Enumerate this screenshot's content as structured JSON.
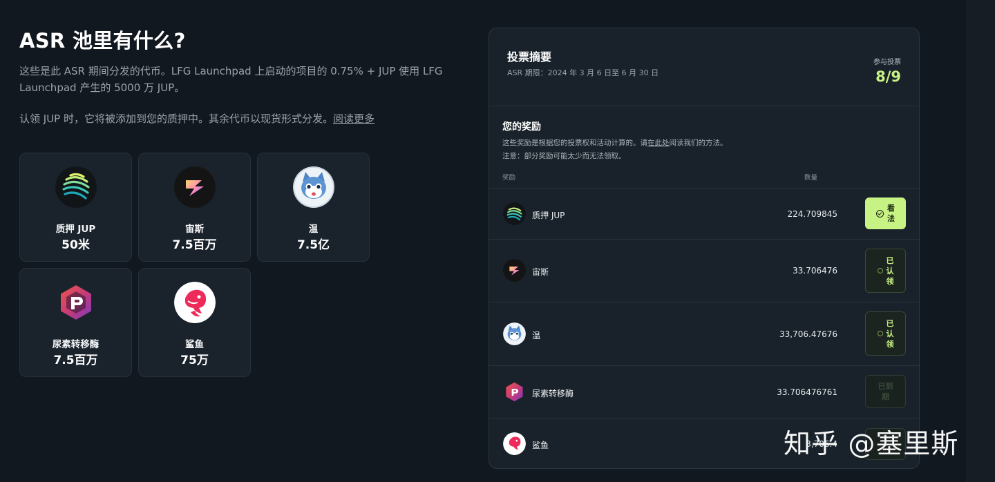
{
  "page": {
    "title": "ASR 池里有什么?",
    "intro": "这些是此 ASR 期间分发的代币。LFG Launchpad 上启动的项目的 0.75% + JUP 使用 LFG Launchpad 产生的 5000 万 JUP。",
    "note": "认领 JUP 时，它将被添加到您的质押中。其余代币以现货形式分发。",
    "read_more": "阅读更多"
  },
  "tokens": [
    {
      "name": "质押 JUP",
      "amount": "50米",
      "icon": "jupiter-logo-icon"
    },
    {
      "name": "宙斯",
      "amount": "7.5百万",
      "icon": "zeus-logo-icon"
    },
    {
      "name": "温",
      "amount": "7.5亿",
      "icon": "wen-cat-logo-icon"
    },
    {
      "name": "尿素转移酶",
      "amount": "7.5百万",
      "icon": "upt-logo-icon"
    },
    {
      "name": "鲨鱼",
      "amount": "75万",
      "icon": "shark-logo-icon"
    }
  ],
  "summary": {
    "title": "投票摘要",
    "period": "ASR 期限：2024 年 3 月 6 日至 6 月 30 日",
    "vote_label": "参与投票",
    "vote_count": "8/9"
  },
  "rewards": {
    "title": "您的奖励",
    "desc_before": "这些奖励是根据您的投票权和活动计算的。请",
    "desc_link": "在此处",
    "desc_after": "阅读我们的方法。",
    "note": "注意：部分奖励可能太少而无法领取。",
    "col_reward": "奖励",
    "col_qty": "数量",
    "rows": [
      {
        "name": "质押 JUP",
        "qty": "224.709845",
        "status_line1": "看",
        "status_line2": "法",
        "status_line3": "",
        "state": "active"
      },
      {
        "name": "宙斯",
        "qty": "33.706476",
        "status_line1": "已",
        "status_line2": "认",
        "status_line3": "领",
        "state": "claimed"
      },
      {
        "name": "温",
        "qty": "33,706.47676",
        "status_line1": "已",
        "status_line2": "认",
        "status_line3": "领",
        "state": "claimed"
      },
      {
        "name": "尿素转移酶",
        "qty": "33.706476761",
        "status_line1": "已到",
        "status_line2": "期",
        "status_line3": "",
        "state": "expired"
      },
      {
        "name": "鲨鱼",
        "qty": "3,706.4",
        "status_line1": "",
        "status_line2": "",
        "status_line3": "",
        "state": "expired"
      }
    ]
  },
  "watermark": "知乎 @塞里斯",
  "colors": {
    "background": "#121820",
    "panel": "#19222a",
    "accent": "#c7f284"
  }
}
